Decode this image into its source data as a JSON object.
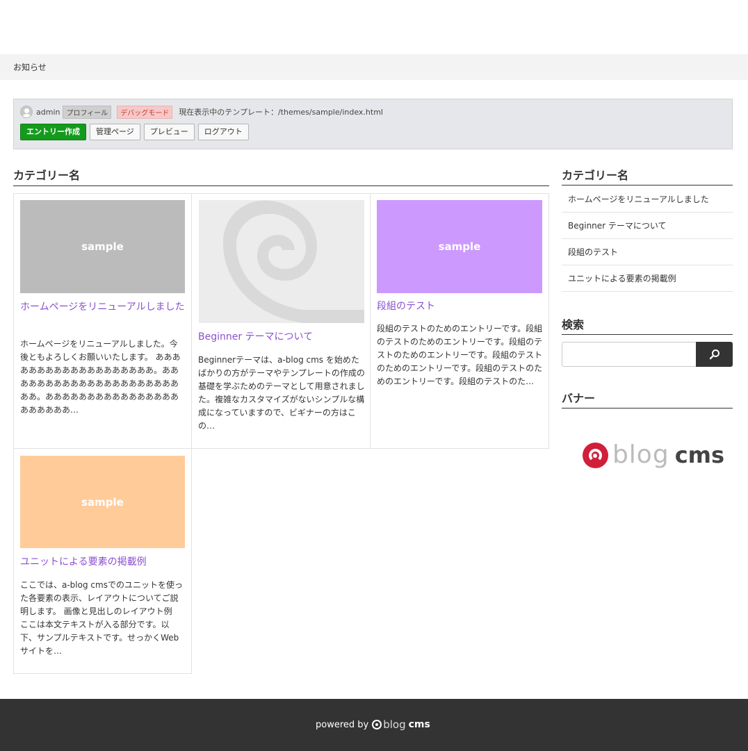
{
  "breadcrumb": {
    "label": "お知らせ"
  },
  "admin": {
    "username": "admin",
    "profile_tag": "プロフィール",
    "debug_tag": "デバッグモード",
    "template_info": "現在表示中のテンプレート：/themes/sample/index.html",
    "buttons": [
      "エントリー作成",
      "管理ページ",
      "プレビュー",
      "ログアウト"
    ]
  },
  "main": {
    "heading": "カテゴリー名",
    "entries": [
      {
        "title": "ホームページをリニューアルしました",
        "thumb_text": "sample",
        "thumb_color": "#bbbbbb",
        "body": "ホームページをリニューアルしました。今後ともよろしくお願いいたします。 あああああああああああああああああああ。あああああああああああああああああああああああ。ああああああああああああああああああああああ…"
      },
      {
        "title": "Beginner テーマについて",
        "thumb_text": "",
        "thumb_color": "#ececec",
        "body": "Beginnerテーマは、a-blog cms を始めたばかりの方がテーマやテンプレートの作成の基礎を学ぶためのテーマとして用意されました。複雑なカスタマイズがないシンプルな構成になっていますので、ビギナーの方はこの…"
      },
      {
        "title": "段組のテスト",
        "thumb_text": "sample",
        "thumb_color": "#cc99ff",
        "body": "段組のテストのためのエントリーです。段組のテストのためのエントリーです。段組のテストのためのエントリーです。段組のテストのためのエントリーです。段組のテストのためのエントリーです。段組のテストのた…"
      },
      {
        "title": "ユニットによる要素の掲載例",
        "thumb_text": "sample",
        "thumb_color": "#ffcc99",
        "body": "ここでは、a-blog cmsでのユニットを使った各要素の表示、レイアウトについてご説明します。 画像と見出しのレイアウト例 ここは本文テキストが入る部分です。以下、サンプルテキストです。せっかくWebサイトを…"
      }
    ]
  },
  "sidebar": {
    "category_heading": "カテゴリー名",
    "category_items": [
      "ホームページをリニューアルしました",
      "Beginner テーマについて",
      "段組のテスト",
      "ユニットによる要素の掲載例"
    ],
    "search_heading": "検索",
    "search_placeholder": "",
    "banner_heading": "バナー",
    "banner_logo": {
      "word1": "blog",
      "word2": "cms",
      "brand_color": "#d11f3a"
    }
  },
  "footer": {
    "powered_by": "powered by",
    "logo_word1": "blog",
    "logo_word2": "cms"
  }
}
